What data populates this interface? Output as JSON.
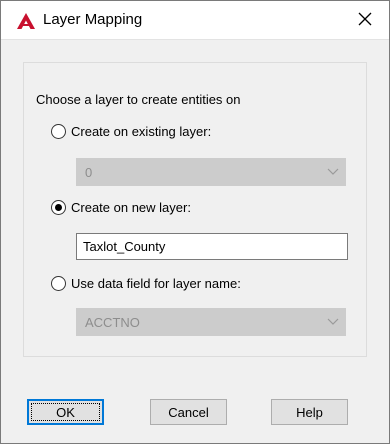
{
  "window": {
    "title": "Layer Mapping",
    "close_icon": "close-icon",
    "app_icon": "autocad-logo-icon",
    "accent_color": "#c8102e"
  },
  "group": {
    "legend": "Choose a layer to create entities on"
  },
  "options": [
    {
      "label": "Create on existing layer:",
      "checked": false
    },
    {
      "label": "Create on new layer:",
      "checked": true
    },
    {
      "label": "Use data field for layer name:",
      "checked": false
    }
  ],
  "existing_layer": {
    "value": "0",
    "disabled": true
  },
  "new_layer": {
    "value": "Taxlot_County"
  },
  "data_field": {
    "value": "ACCTNO",
    "disabled": true
  },
  "buttons": {
    "ok": "OK",
    "cancel": "Cancel",
    "help": "Help"
  }
}
